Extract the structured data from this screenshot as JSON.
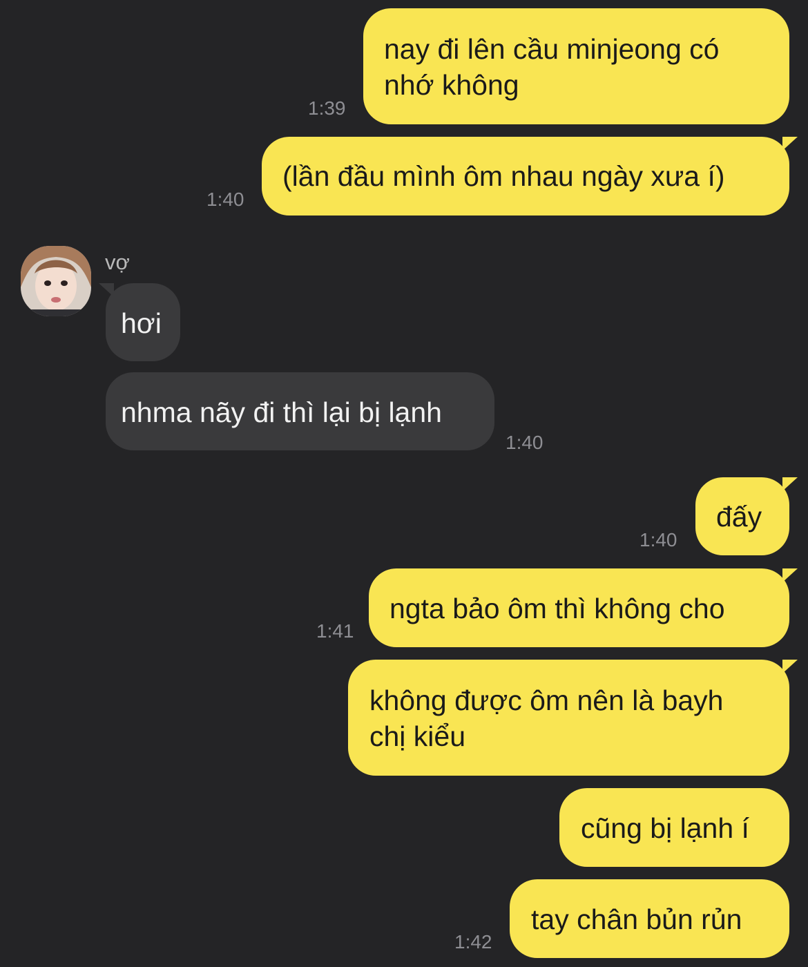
{
  "contact": {
    "name": "vợ"
  },
  "messages": [
    {
      "id": "m1",
      "side": "sent",
      "lines": [
        "nay đi lên cầu minjeong có",
        "nhớ không"
      ],
      "time": "1:39"
    },
    {
      "id": "m2",
      "side": "sent",
      "lines": [
        "(lần đầu mình ôm nhau ngày xưa í)"
      ],
      "time": "1:40"
    },
    {
      "id": "m3",
      "side": "received",
      "lines": [
        "hơi"
      ],
      "time": ""
    },
    {
      "id": "m4",
      "side": "received",
      "lines": [
        "nhma nãy đi thì lại bị lạnh"
      ],
      "time": "1:40"
    },
    {
      "id": "m5",
      "side": "sent",
      "lines": [
        "đấy"
      ],
      "time": "1:40"
    },
    {
      "id": "m6",
      "side": "sent",
      "lines": [
        "ngta bảo ôm thì không cho"
      ],
      "time": "1:41"
    },
    {
      "id": "m7",
      "side": "sent",
      "lines": [
        "không được ôm nên là bayh",
        "chị kiểu"
      ],
      "time": ""
    },
    {
      "id": "m8",
      "side": "sent",
      "lines": [
        "cũng bị lạnh í"
      ],
      "time": ""
    },
    {
      "id": "m9",
      "side": "sent",
      "lines": [
        "tay chân bủn rủn"
      ],
      "time": "1:42"
    }
  ],
  "colors": {
    "background": "#242426",
    "sent_bubble": "#F9E553",
    "received_bubble": "#3A3A3C",
    "timestamp": "#8E8E93"
  }
}
